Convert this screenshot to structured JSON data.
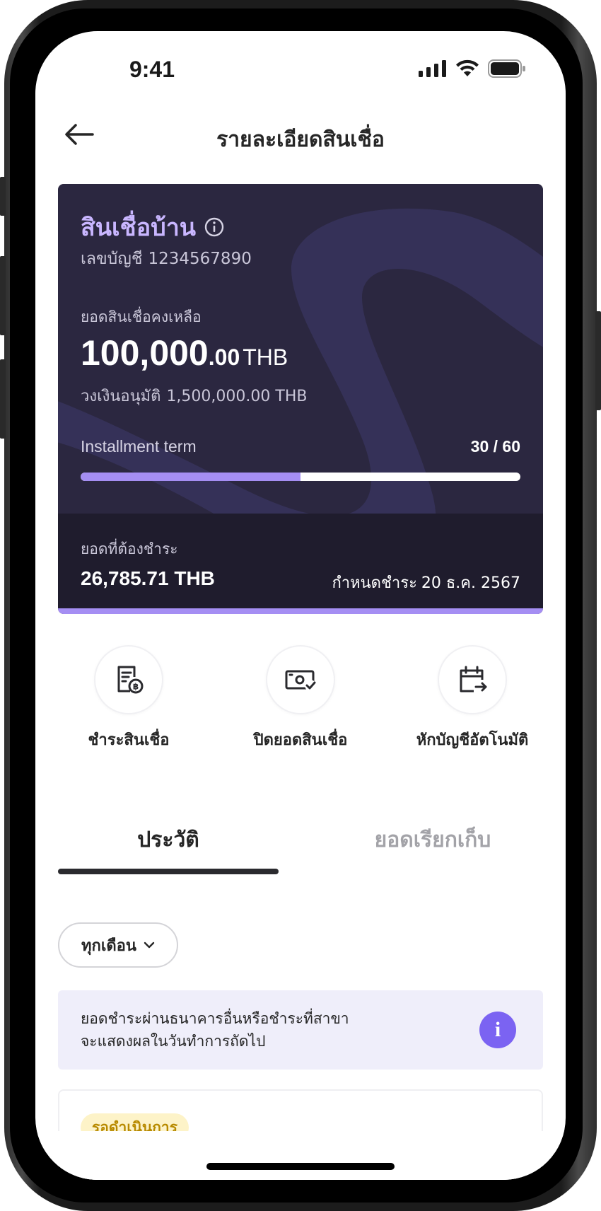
{
  "status_bar": {
    "time": "9:41"
  },
  "header": {
    "title": "รายละเอียดสินเชื่อ"
  },
  "loan_card": {
    "product_name": "สินเชื่อบ้าน",
    "account_label": "เลขบัญชี",
    "account_number": "1234567890",
    "balance_label": "ยอดสินเชื่อคงเหลือ",
    "balance_integer": "100,000",
    "balance_decimal": ".00",
    "currency": "THB",
    "limit_label": "วงเงินอนุมัติ",
    "limit_value": "1,500,000.00 THB",
    "term_label": "Installment term",
    "term_value": "30 / 60",
    "term_progress": 0.5,
    "due_label": "ยอดที่ต้องชำระ",
    "due_amount": "26,785.71 THB",
    "due_date_label": "กำหนดชำระ",
    "due_date_value": "20 ธ.ค. 2567",
    "colors": {
      "background": "#2b2740",
      "accent": "#a58ef3",
      "title": "#c9b6ff"
    }
  },
  "actions": [
    {
      "label": "ชำระสินเชื่อ",
      "icon": "bill-baht-icon"
    },
    {
      "label": "ปิดยอดสินเชื่อ",
      "icon": "cash-check-icon"
    },
    {
      "label": "หักบัญชีอัตโนมัติ",
      "icon": "calendar-transfer-icon"
    }
  ],
  "tabs": [
    {
      "label": "ประวัติ",
      "active": true
    },
    {
      "label": "ยอดเรียกเก็บ",
      "active": false
    }
  ],
  "filter": {
    "selected": "ทุกเดือน"
  },
  "info_banner": {
    "line1": "ยอดชำระผ่านธนาคารอื่นหรือชำระที่สาขา",
    "line2": "จะแสดงผลในวันทำการถัดไป",
    "icon_text": "i"
  },
  "history": [
    {
      "status": "รอดำเนินการ"
    }
  ]
}
